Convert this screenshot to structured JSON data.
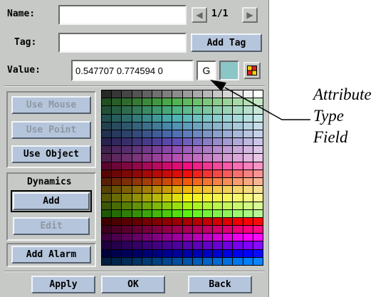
{
  "form": {
    "name_label": "Name:",
    "name_value": "",
    "tag_label": "Tag:",
    "tag_value": "",
    "value_label": "Value:",
    "value_text": "0.547707 0.774594 0",
    "page_indicator": "1/1",
    "add_tag_label": "Add Tag",
    "type_field_text": "G",
    "swatch_color": "#8ac6c6"
  },
  "left_buttons": {
    "use_mouse": "Use Mouse",
    "use_point": "Use Point",
    "use_object": "Use Object",
    "dynamics_title": "Dynamics",
    "add": "Add",
    "edit": "Edit",
    "add_alarm": "Add Alarm"
  },
  "bottom_buttons": {
    "apply": "Apply",
    "ok": "OK",
    "back": "Back"
  },
  "icons": {
    "prev": "left-arrow-icon",
    "next": "right-arrow-icon",
    "palette": "color-palette-icon"
  },
  "annotation": {
    "line1": "Attribute",
    "line2": "Type",
    "line3": "Field"
  }
}
